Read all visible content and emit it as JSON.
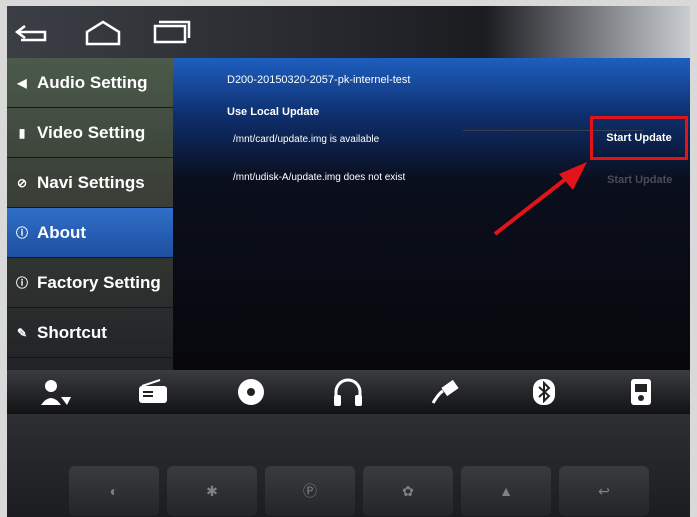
{
  "sidebar": {
    "items": [
      {
        "icon": "speaker-icon",
        "label": "Audio Setting"
      },
      {
        "icon": "video-icon",
        "label": "Video Setting"
      },
      {
        "icon": "compass-icon",
        "label": "Navi Settings"
      },
      {
        "icon": "info-icon",
        "label": "About",
        "active": true
      },
      {
        "icon": "info-icon",
        "label": "Factory Setting"
      },
      {
        "icon": "shortcut-icon",
        "label": "Shortcut"
      }
    ]
  },
  "main": {
    "build": "D200-20150320-2057-pk-internel-test",
    "section": "Use Local Update",
    "card_status": "/mnt/card/update.img is available",
    "udisk_status": "/mnt/udisk-A/update.img does not exist",
    "start_update": "Start Update",
    "start_update_dim": "Start Update"
  },
  "sysbar": {
    "icons": [
      "back-icon",
      "home-icon",
      "recent-apps-icon"
    ]
  },
  "dock": {
    "icons": [
      "navigation-icon",
      "radio-icon",
      "disc-icon",
      "headphones-icon",
      "usb-icon",
      "bluetooth-icon",
      "media-player-icon"
    ]
  },
  "hardware_keys": [
    "mute-icon",
    "bluetooth-icon",
    "parking-icon",
    "settings-icon",
    "eject-icon",
    "back-icon"
  ],
  "colors": {
    "accent": "#1f5fc6",
    "highlight": "#e2141a"
  }
}
